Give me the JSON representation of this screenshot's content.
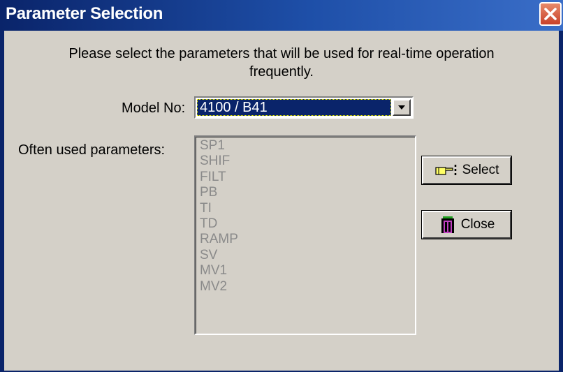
{
  "window": {
    "title": "Parameter Selection",
    "close_icon": "close-x-icon"
  },
  "prompt": {
    "line1": "Please select the parameters that will be used for real-time operation",
    "line2": "frequently."
  },
  "model": {
    "label": "Model No:",
    "selected": "4100 / B41",
    "dropdown_icon": "chevron-down-icon"
  },
  "parameters": {
    "label": "Often used parameters:",
    "items": [
      "SP1",
      "SHIF",
      "FILT",
      "PB",
      "TI",
      "TD",
      "RAMP",
      "SV",
      "MV1",
      "MV2"
    ]
  },
  "buttons": {
    "select_label": "Select",
    "select_icon": "pointing-hand-icon",
    "close_label": "Close",
    "close_icon": "exit-door-icon"
  },
  "colors": {
    "title_bar": "#0a246a",
    "dialog_bg": "#d4d0c8",
    "selection_bg": "#0a246a",
    "disabled_text": "#8a8a8a"
  }
}
